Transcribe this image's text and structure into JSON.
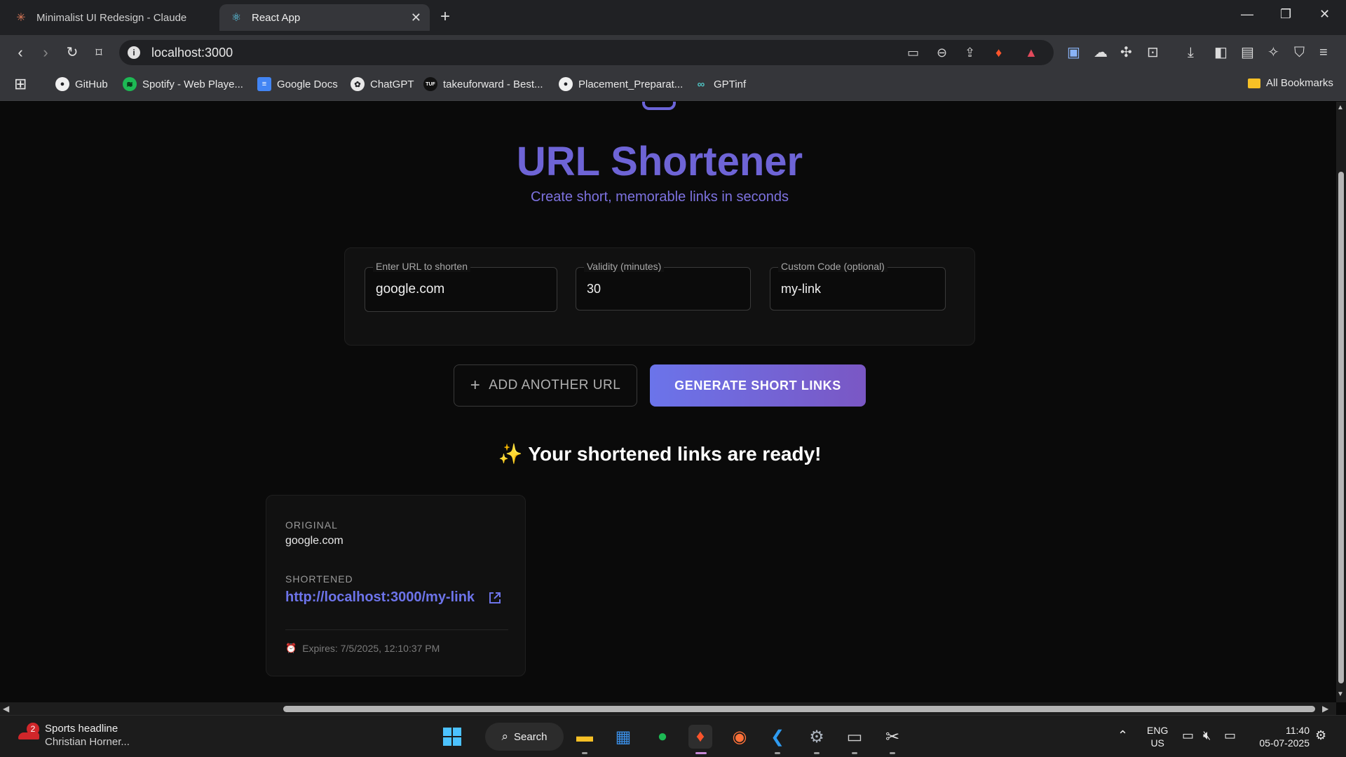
{
  "browser": {
    "tabs": [
      {
        "title": "Minimalist UI Redesign - Claude",
        "icon": "claude-icon",
        "active": false
      },
      {
        "title": "React App",
        "icon": "react-icon",
        "active": true
      }
    ],
    "address": "localhost:3000",
    "bookmarks": [
      {
        "label": "GitHub",
        "icon": "github-icon"
      },
      {
        "label": "Spotify - Web Playe...",
        "icon": "spotify-icon"
      },
      {
        "label": "Google Docs",
        "icon": "google-docs-icon"
      },
      {
        "label": "ChatGPT",
        "icon": "chatgpt-icon"
      },
      {
        "label": "takeuforward - Best...",
        "icon": "tuf-icon"
      },
      {
        "label": "Placement_Preparat...",
        "icon": "github-icon"
      },
      {
        "label": "GPTinf",
        "icon": "gptinf-icon"
      }
    ],
    "all_bookmarks": "All Bookmarks"
  },
  "page": {
    "title": "URL Shortener",
    "subtitle": "Create short, memorable links in seconds",
    "form": {
      "url_label": "Enter URL to shorten",
      "url_value": "google.com",
      "validity_label": "Validity (minutes)",
      "validity_value": "30",
      "code_label": "Custom Code (optional)",
      "code_value": "my-link"
    },
    "add_button": "ADD ANOTHER URL",
    "generate_button": "GENERATE SHORT LINKS",
    "results_heading": "Your shortened links are ready!",
    "results": [
      {
        "original_caption": "ORIGINAL",
        "original": "google.com",
        "shortened_caption": "SHORTENED",
        "shortened": "http://localhost:3000/my-link",
        "expires": "Expires: 7/5/2025, 12:10:37 PM"
      }
    ]
  },
  "taskbar": {
    "news_badge": "2",
    "news_title": "Sports headline",
    "news_sub": "Christian Horner...",
    "search_label": "Search",
    "lang_1": "ENG",
    "lang_2": "US",
    "time": "11:40",
    "date": "05-07-2025"
  },
  "colors": {
    "accent": "#6e64d6",
    "link": "#6d74ea",
    "gradient_start": "#6b74ea",
    "gradient_end": "#7a57c4"
  }
}
